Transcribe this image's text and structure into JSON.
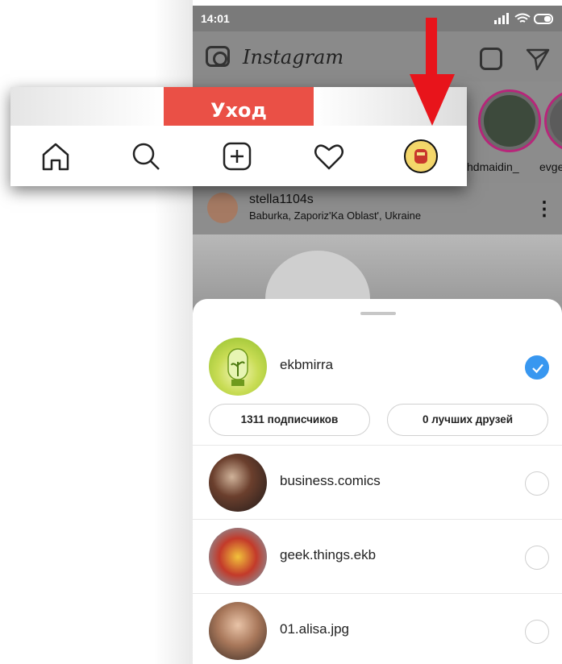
{
  "status_bar": {
    "time": "14:01",
    "icons": "▎▎↑ ▭"
  },
  "header": {
    "app_name": "Instagram"
  },
  "stories": [
    {
      "label": ""
    },
    {
      "label": "hdmaidin_"
    },
    {
      "label": "evge"
    }
  ],
  "post": {
    "username": "stella1104s",
    "location": "Baburka, Zaporiz'Ka Oblast', Ukraine",
    "more": "⋮"
  },
  "sheet": {
    "current_account": {
      "name": "ekbmirra",
      "selected": true,
      "followers_label": "1311 подписчиков",
      "close_friends_label": "0 лучших друзей"
    },
    "other_accounts": [
      {
        "name": "business.comics",
        "selected": false
      },
      {
        "name": "geek.things.ekb",
        "selected": false
      },
      {
        "name": "01.alisa.jpg",
        "selected": false
      }
    ]
  },
  "zoom": {
    "banner_text": "Уход",
    "nav_icons": [
      "home-icon",
      "search-icon",
      "new-post-icon",
      "heart-icon",
      "profile-avatar"
    ]
  },
  "colors": {
    "accent": "#3897f0",
    "arrow": "#e8141b",
    "banner": "#ea5046"
  }
}
